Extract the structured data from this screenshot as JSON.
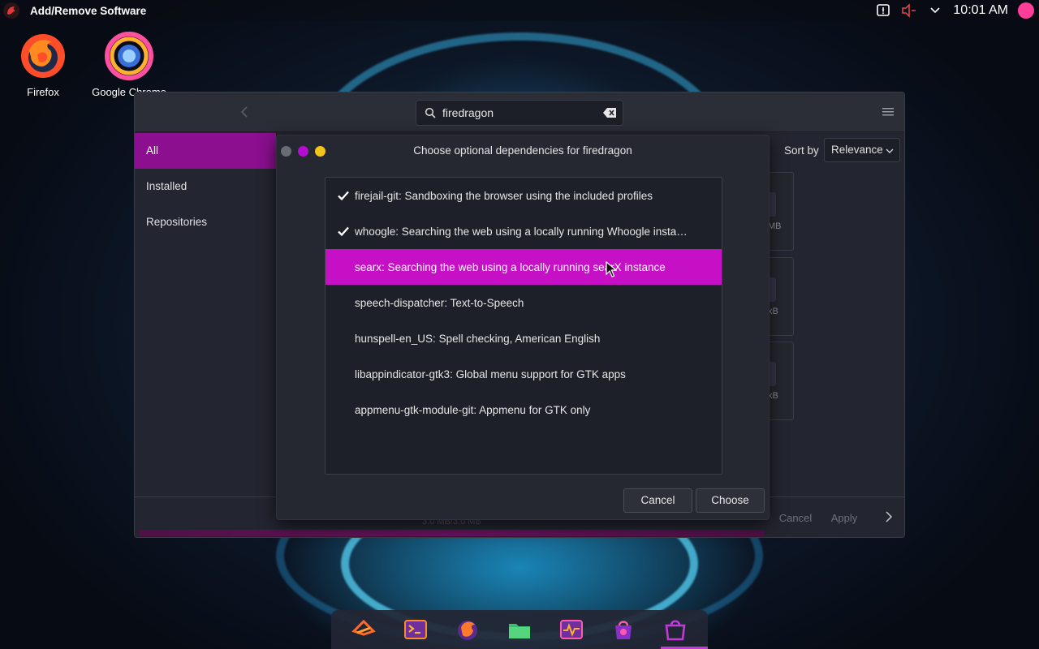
{
  "top_panel": {
    "active_app": "Add/Remove Software",
    "clock": "10:01 AM",
    "tray_icons": [
      "notification-icon",
      "volume-muted-icon",
      "chevron-down-icon",
      "user-avatar"
    ]
  },
  "desktop": {
    "icons": [
      {
        "label": "Firefox",
        "icon": "firefox-icon"
      },
      {
        "label": "Google Chrome",
        "icon": "chrome-icon"
      }
    ]
  },
  "window": {
    "search": {
      "value": "firedragon",
      "placeholder": ""
    },
    "sidebar": {
      "items": [
        {
          "label": "All",
          "active": true
        },
        {
          "label": "Installed",
          "active": false
        },
        {
          "label": "Repositories",
          "active": false
        }
      ]
    },
    "sort": {
      "label": "Sort by",
      "selected": "Relevance"
    },
    "package_sizes": [
      "MB",
      "kB",
      "kB"
    ],
    "bottom": {
      "progress_text": "3.0 MB/3.0 MB",
      "cancel_label": "Cancel",
      "apply_label": "Apply"
    }
  },
  "dialog": {
    "title": "Choose optional dependencies for firedragon",
    "dependencies": [
      {
        "text": "firejail-git: Sandboxing the browser using the included profiles",
        "checked": true,
        "selected": false
      },
      {
        "text": "whoogle: Searching the web using a locally running Whoogle instance",
        "checked": true,
        "selected": false
      },
      {
        "text": "searx: Searching the web using a locally running searX instance",
        "checked": false,
        "selected": true
      },
      {
        "text": "speech-dispatcher: Text-to-Speech",
        "checked": false,
        "selected": false
      },
      {
        "text": "hunspell-en_US: Spell checking, American English",
        "checked": false,
        "selected": false
      },
      {
        "text": "libappindicator-gtk3: Global menu support for GTK apps",
        "checked": false,
        "selected": false
      },
      {
        "text": "appmenu-gtk-module-git: Appmenu for GTK only",
        "checked": false,
        "selected": false
      }
    ],
    "cancel_label": "Cancel",
    "choose_label": "Choose"
  },
  "dock": {
    "items": [
      "app-launcher-icon",
      "terminal-icon",
      "firedragon-icon",
      "files-icon",
      "system-monitor-icon",
      "software-store-icon",
      "add-remove-software-icon"
    ]
  },
  "colors": {
    "accent": "#c610c5",
    "sidebar_active": "#8b0f8e",
    "window_bg": "#232530",
    "dialog_bg": "#252731",
    "wbtn_gray": "#6a6c74",
    "wbtn_purple": "#b40cd2",
    "wbtn_yellow": "#f3c51a"
  }
}
